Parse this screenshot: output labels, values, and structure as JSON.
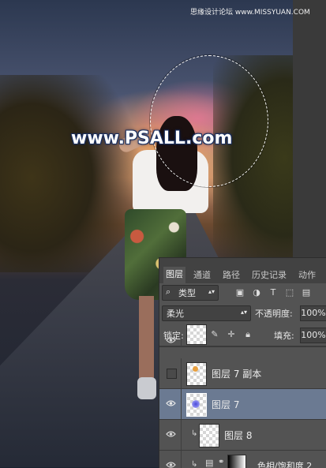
{
  "watermarks": {
    "site_small": "思缘设计论坛 www.MISSYUAN.COM",
    "main": "www.PSALL.com"
  },
  "layers_panel": {
    "tabs": [
      {
        "label": "图层",
        "active": true
      },
      {
        "label": "通道",
        "active": false
      },
      {
        "label": "路径",
        "active": false
      },
      {
        "label": "历史记录",
        "active": false
      },
      {
        "label": "动作",
        "active": false
      }
    ],
    "filter_kind": "类型",
    "blend_mode": "柔光",
    "opacity_label": "不透明度:",
    "opacity_value": "100%",
    "lock_label": "锁定:",
    "fill_label": "填充:",
    "fill_value": "100%",
    "layers": [
      {
        "name": "",
        "visible": true,
        "selected": false
      },
      {
        "name": "图层 7 副本",
        "visible": false,
        "selected": false
      },
      {
        "name": "图层 7",
        "visible": true,
        "selected": true
      },
      {
        "name": "图层 8",
        "visible": true,
        "selected": false,
        "clipped": true
      },
      {
        "name": "色相/饱和度 2",
        "visible": true,
        "selected": false,
        "clipped": true
      }
    ]
  },
  "colors": {
    "panel_bg": "#535353",
    "selected_row": "#6b7a92"
  }
}
